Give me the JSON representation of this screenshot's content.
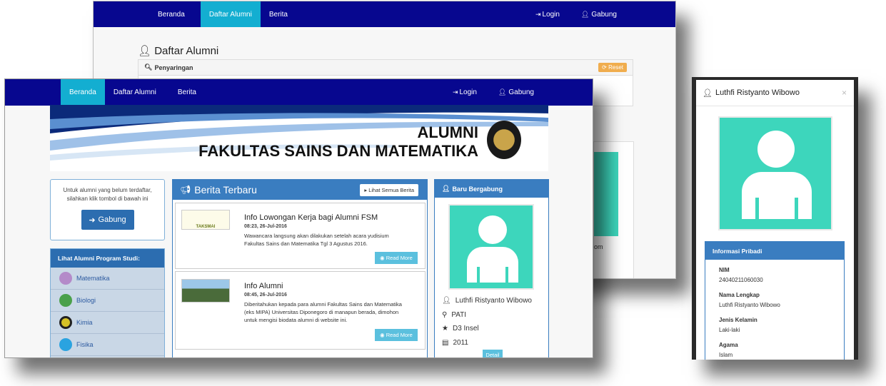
{
  "back": {
    "nav": {
      "beranda": "Beranda",
      "daftar": "Daftar Alumni",
      "berita": "Berita",
      "login": "Login",
      "gabung": "Gabung"
    },
    "title": "Daftar Alumni",
    "filter_label": "Penyaringan",
    "reset": "Reset",
    "partial_text": "om"
  },
  "front": {
    "nav": {
      "beranda": "Beranda",
      "daftar": "Daftar Alumni",
      "berita": "Berita",
      "login": "Login",
      "gabung": "Gabung"
    },
    "banner": {
      "line1": "ALUMNI",
      "line2": "FAKULTAS SAINS DAN MATEMATIKA"
    },
    "join_box": {
      "text": "Untuk alumni yang belum terdaftar, silahkan klik tombol di bawah ini",
      "button": "Gabung"
    },
    "prodi": {
      "title": "Lihat Alumni Program Studi:",
      "items": [
        "Matematika",
        "Biologi",
        "Kimia",
        "Fisika"
      ]
    },
    "news": {
      "title": "Berita Terbaru",
      "see_all": "Lihat Semua Berita",
      "items": [
        {
          "title": "Info Lowongan Kerja bagi Alumni FSM",
          "time": "08:23, 26-Jul-2016",
          "desc": "Wawancara langsung akan dilakukan setelah acara yudisium Fakultas Sains dan Matematika Tgl 3 Agustus 2016.",
          "button": "Read More",
          "thumb_text": "TAKSMAI"
        },
        {
          "title": "Info Alumni",
          "time": "08:45, 26-Jul-2016",
          "desc": "Diberitahukan kepada para alumni Fakultas Sains dan Matematika (eks MIPA) Universitas Diponegoro di manapun berada, dimohon untuk mengisi biodata alumni di website ini.",
          "button": "Read More"
        }
      ]
    },
    "newest": {
      "title": "Baru Bergabung",
      "name": "Luthfi Ristyanto Wibowo",
      "city": "PATI",
      "program": "D3 Insel",
      "year": "2011",
      "detail": "Detail"
    }
  },
  "modal": {
    "title": "Luthfi Ristyanto Wibowo",
    "close": "×",
    "section": "Informasi Pribadi",
    "fields": [
      {
        "label": "NIM",
        "value": "24040211060030"
      },
      {
        "label": "Nama Lengkap",
        "value": "Luthfi Ristyanto Wibowo"
      },
      {
        "label": "Jenis Kelamin",
        "value": "Laki-laki"
      },
      {
        "label": "Agama",
        "value": "Islam"
      }
    ]
  },
  "colors": {
    "navbar": "#07078f",
    "nav_active": "#13aed1",
    "avatar_bg": "#3dd6bc",
    "panel_blue": "#3a7dc0",
    "btn_blue": "#2c6db0",
    "btn_cyan": "#5bc0de",
    "reset_orange": "#f0ad4e",
    "sidebar_bg": "#c9d7e6"
  }
}
